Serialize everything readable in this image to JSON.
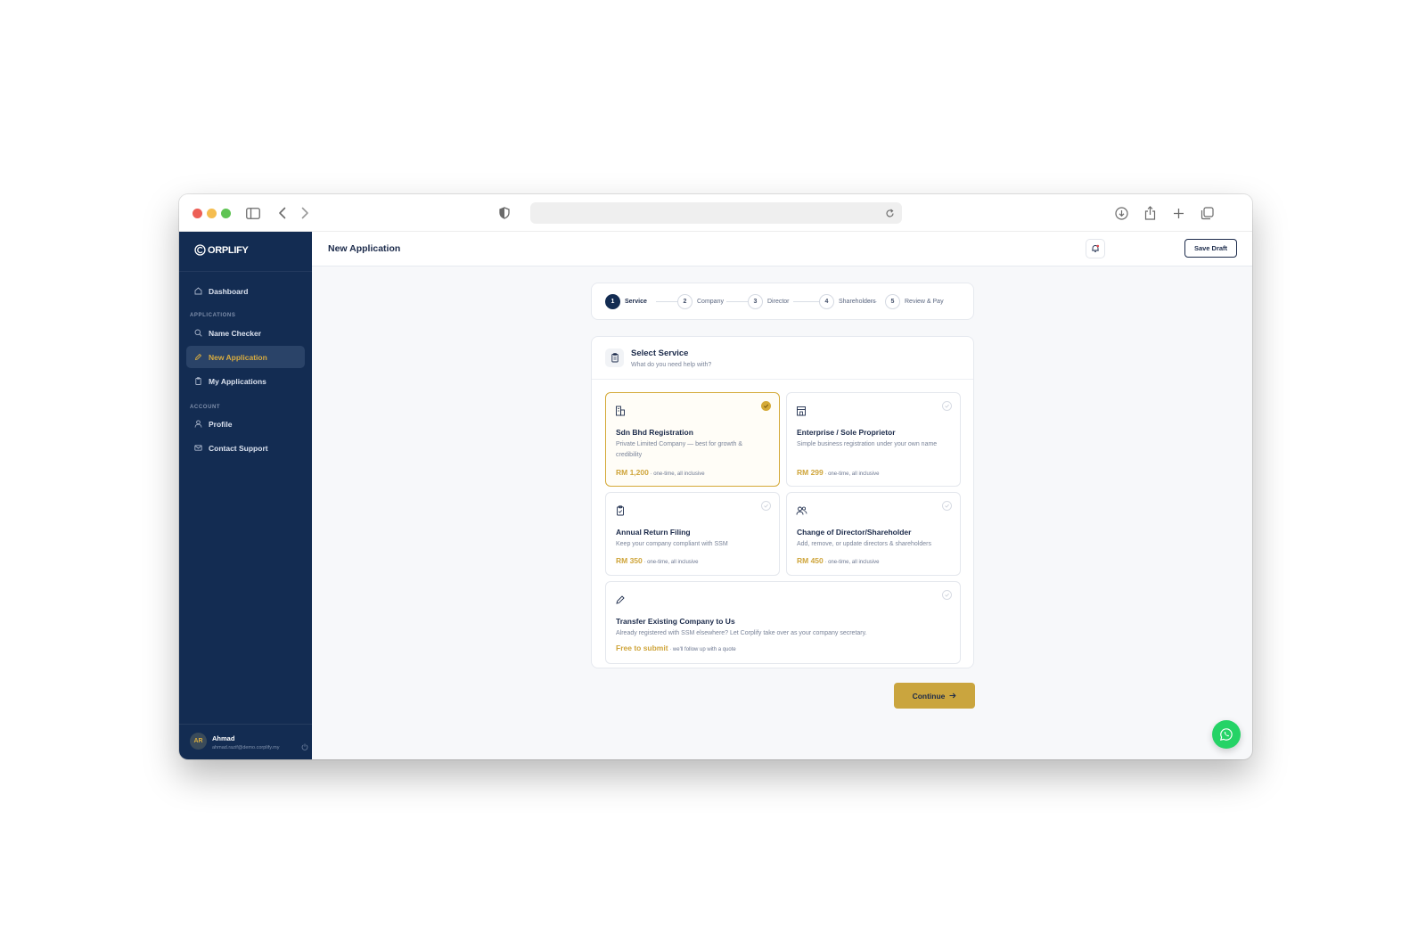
{
  "app": {
    "brand": "ORPLIFY",
    "page_title": "New Application"
  },
  "sidebar": {
    "items": [
      {
        "label": "Dashboard",
        "icon": "home-icon"
      },
      {
        "label": "Name Checker",
        "icon": "search-icon"
      },
      {
        "label": "New Application",
        "icon": "pencil-icon",
        "active": true
      },
      {
        "label": "My Applications",
        "icon": "clipboard-icon"
      },
      {
        "label": "Profile",
        "icon": "user-icon"
      },
      {
        "label": "Contact Support",
        "icon": "mail-icon"
      }
    ],
    "sections": [
      "APPLICATIONS",
      "ACCOUNT"
    ],
    "user": {
      "initials": "AR",
      "name": "Ahmad",
      "email": "ahmad.razif@demo.corplify.my"
    }
  },
  "header": {
    "save_draft": "Save Draft"
  },
  "stepper": {
    "steps": [
      {
        "num": "1",
        "label": "Service",
        "active": true
      },
      {
        "num": "2",
        "label": "Company"
      },
      {
        "num": "3",
        "label": "Director"
      },
      {
        "num": "4",
        "label": "Shareholders"
      },
      {
        "num": "5",
        "label": "Review & Pay"
      }
    ]
  },
  "service": {
    "title": "Select Service",
    "subtitle": "What do you need help with?",
    "options": [
      {
        "title": "Sdn Bhd Registration",
        "desc": "Private Limited Company — best for growth & credibility",
        "price": "RM 1,200",
        "note": " · one-time, all inclusive",
        "selected": true,
        "icon": "building-icon"
      },
      {
        "title": "Enterprise / Sole Proprietor",
        "desc": "Simple business registration under your own name",
        "price": "RM 299",
        "note": " · one-time, all inclusive",
        "icon": "store-icon"
      },
      {
        "title": "Annual Return Filing",
        "desc": "Keep your company compliant with SSM",
        "price": "RM 350",
        "note": " · one-time, all inclusive",
        "icon": "clipboard-check-icon"
      },
      {
        "title": "Change of Director/Shareholder",
        "desc": "Add, remove, or update directors & shareholders",
        "price": "RM 450",
        "note": " · one-time, all inclusive",
        "icon": "users-icon"
      },
      {
        "title": "Transfer Existing Company to Us",
        "desc": "Already registered with SSM elsewhere? Let Corplify take over as your company secretary.",
        "price": "Free to submit",
        "note": " · we'll follow up with a quote",
        "icon": "pencil-icon"
      }
    ]
  },
  "actions": {
    "continue": "Continue"
  },
  "colors": {
    "sidebar": "#132c52",
    "accent": "#d4a937",
    "whatsapp": "#25d366"
  }
}
